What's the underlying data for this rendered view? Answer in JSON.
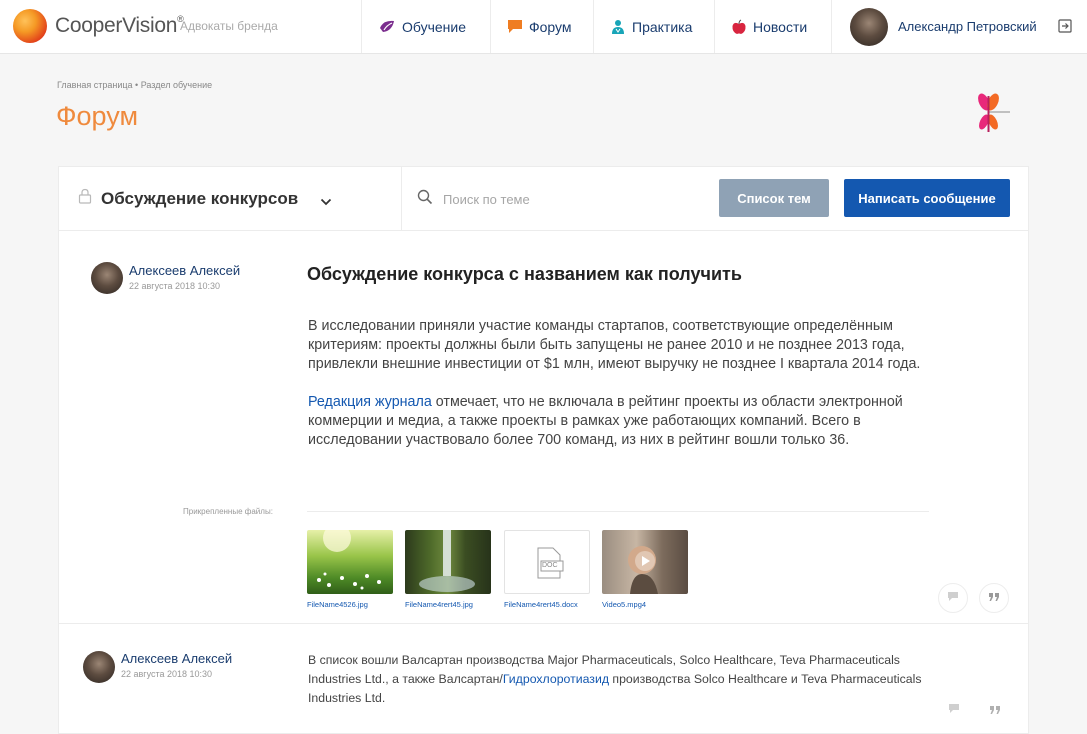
{
  "header": {
    "brand": "CooperVision",
    "brand_mark": "®",
    "subtitle": "Адвокаты бренда",
    "nav": [
      {
        "label": "Обучение",
        "icon": "graduation-icon",
        "color": "#7b2e8e"
      },
      {
        "label": "Форум",
        "icon": "chat-icon",
        "color": "#ef7d22"
      },
      {
        "label": "Практика",
        "icon": "doctor-icon",
        "color": "#18a5b8"
      },
      {
        "label": "Новости",
        "icon": "apple-icon",
        "color": "#d8253f"
      }
    ],
    "user": {
      "name": "Александр Петровский"
    }
  },
  "breadcrumb": "Главная страница • Раздел обучение",
  "page_title": "Форум",
  "toolbar": {
    "category": "Обсуждение конкурсов",
    "search_placeholder": "Поиск по теме",
    "search_value": "",
    "list_button": "Список тем",
    "write_button": "Написать сообщение"
  },
  "post1": {
    "author": "Алексеев Алексей",
    "date": "22 августа 2018 10:30",
    "title": "Обсуждение конкурса с названием как получить",
    "paragraph1": "В исследовании приняли участие команды стартапов, соответствующие определённым критериям: проекты должны были быть запущены не ранее 2010 и не позднее 2013 года, привлекли внешние инвестиции от $1 млн, имеют выручку не позднее I квартала 2014 года.",
    "paragraph2_link": "Редакция журнала",
    "paragraph2_rest": " отмечает, что не включала в рейтинг проекты из области электронной коммерции и медиа, а также проекты в рамках уже работающих компаний. Всего в исследовании участвовало более 700 команд, из них в рейтинг вошли только 36.",
    "attachments_label": "Прикрепленные файлы:",
    "files": [
      {
        "name": "FileName4526.jpg"
      },
      {
        "name": "FileName4rert45.jpg"
      },
      {
        "name": "FileName4rert45.docx",
        "badge": "DOC"
      },
      {
        "name": "Video5.mpg4"
      }
    ]
  },
  "post2": {
    "author": "Алексеев Алексей",
    "date": "22 августа 2018 10:30",
    "text_before": "В список вошли Валсартан производства Major Pharmaceuticals, Solco Healthcare, Teva Pharmaceuticals Industries Ltd., а также Валсартан/",
    "text_link": "Гидрохлоротиазид",
    "text_after": " производства Solco Healthcare и Teva Pharmaceuticals Industries Ltd."
  },
  "colors": {
    "accent_orange": "#ef8a3d",
    "primary_blue": "#1458b0",
    "secondary_gray": "#8fa2b5"
  }
}
